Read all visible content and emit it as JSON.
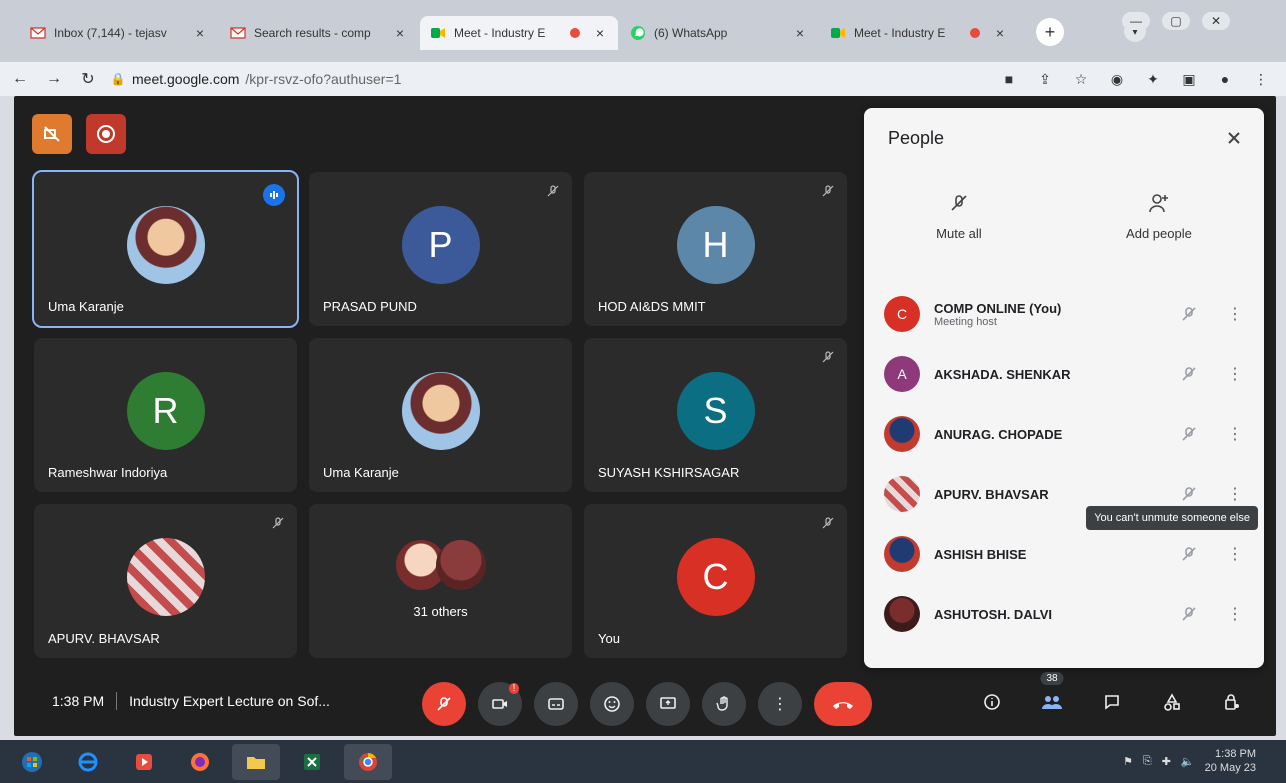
{
  "browser": {
    "tabs": [
      {
        "label": "Inbox (7,144) - tejasv",
        "favicon": "gmail-icon",
        "close": "×",
        "active": false
      },
      {
        "label": "Search results - comp",
        "favicon": "gmail-icon",
        "close": "×",
        "active": false
      },
      {
        "label": "Meet - Industry E",
        "favicon": "meet-icon",
        "close": "×",
        "active": true
      },
      {
        "label": "(6) WhatsApp",
        "favicon": "whatsapp-icon",
        "close": "×",
        "active": false
      },
      {
        "label": "Meet - Industry E",
        "favicon": "meet-icon",
        "close": "×",
        "active": false
      }
    ],
    "newtab": "+",
    "url": {
      "domain": "meet.google.com",
      "path": "/kpr-rsvz-ofo?authuser=1"
    }
  },
  "meet": {
    "tiles": [
      {
        "name": "Uma Karanje",
        "avatar_type": "photo",
        "speaking": true,
        "muted": false
      },
      {
        "name": "PRASAD PUND",
        "avatar_letter": "P",
        "muted": true
      },
      {
        "name": "HOD AI&DS MMIT",
        "avatar_letter": "H",
        "muted": true
      },
      {
        "name": "Rameshwar Indoriya",
        "avatar_letter": "R",
        "muted": false
      },
      {
        "name": "Uma Karanje",
        "avatar_type": "photo",
        "muted": false
      },
      {
        "name": "SUYASH KSHIRSAGAR",
        "avatar_letter": "S",
        "muted": true
      },
      {
        "name": "APURV. BHAVSAR",
        "avatar_type": "stripe",
        "muted": true
      },
      {
        "others_label": "31 others"
      },
      {
        "name": "You",
        "avatar_letter": "C",
        "muted": true
      }
    ],
    "people_panel": {
      "title": "People",
      "mute_all": "Mute all",
      "add_people": "Add people",
      "participants": [
        {
          "name": "COMP ONLINE (You)",
          "sub": "Meeting host",
          "initial": "C",
          "avatar": "red"
        },
        {
          "name": "AKSHADA. SHENKAR",
          "initial": "A",
          "avatar": "purple"
        },
        {
          "name": "ANURAG. CHOPADE",
          "initial": "",
          "avatar": "photo"
        },
        {
          "name": "APURV. BHAVSAR",
          "initial": "",
          "avatar": "stripe"
        },
        {
          "name": "ASHISH BHISE",
          "initial": "",
          "avatar": "photo"
        },
        {
          "name": "ASHUTOSH. DALVI",
          "initial": "",
          "avatar": "dark"
        }
      ],
      "tooltip": "You can't unmute someone else"
    },
    "bottom": {
      "time": "1:38 PM",
      "meeting_title": "Industry Expert Lecture on Sof...",
      "participant_count": "38",
      "reactions_badge": "!"
    }
  },
  "taskbar": {
    "clock_time": "1:38 PM",
    "clock_date": "20 May 23"
  }
}
